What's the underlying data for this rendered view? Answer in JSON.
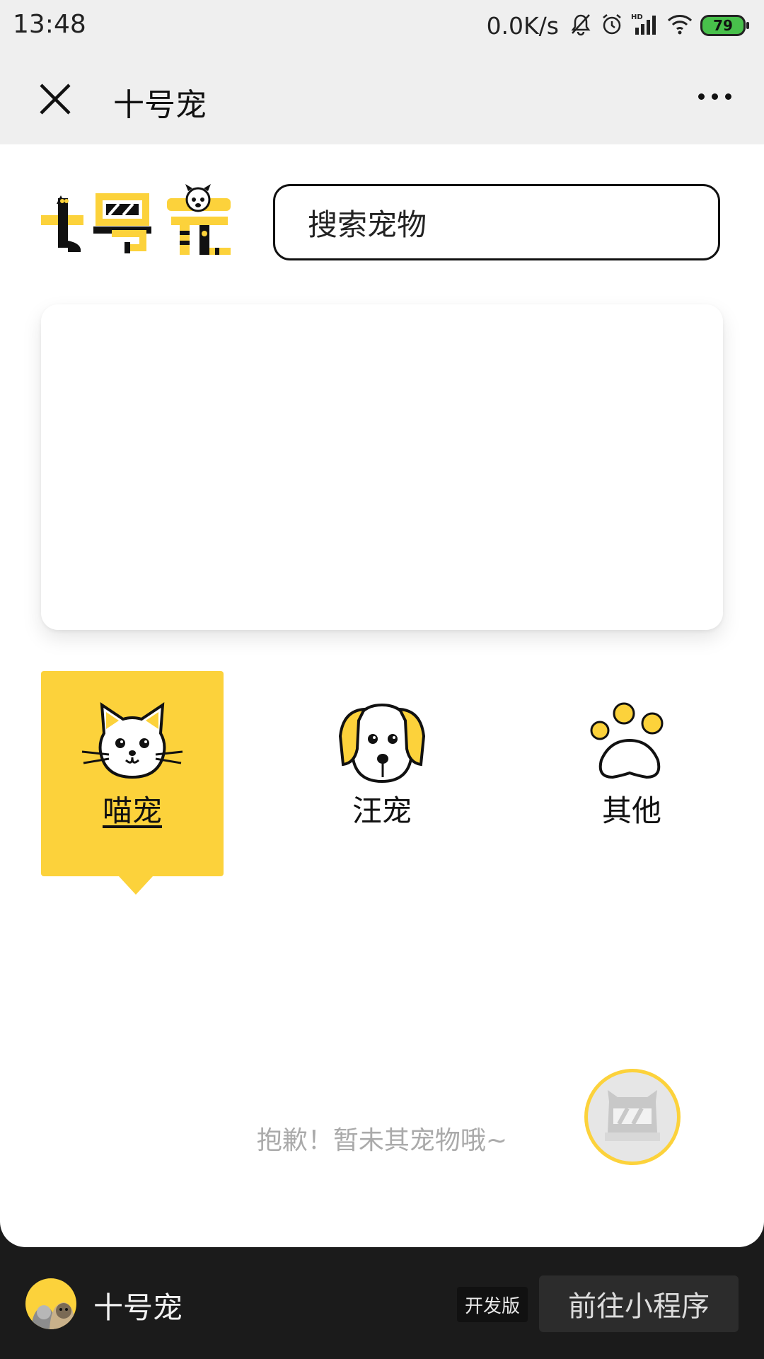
{
  "status_bar": {
    "time": "13:48",
    "net_speed": "0.0K/s",
    "battery": "79",
    "network_label": "HD"
  },
  "title_bar": {
    "title": "十号宠",
    "close_icon": "close-icon",
    "more_icon": "more-dots-icon"
  },
  "search": {
    "placeholder": "搜索宠物"
  },
  "categories": [
    {
      "label": "喵宠",
      "icon": "cat-icon",
      "active": true
    },
    {
      "label": "汪宠",
      "icon": "dog-icon",
      "active": false
    },
    {
      "label": "其他",
      "icon": "paw-icon",
      "active": false
    }
  ],
  "empty_message": "抱歉！暂未其宠物哦~",
  "bottom_bar": {
    "app_name": "十号宠",
    "badge": "开发版",
    "goto_label": "前往小程序"
  },
  "colors": {
    "accent": "#fcd23b",
    "bar_bg": "#efefef",
    "bottom_bg": "#1b1b1b"
  }
}
